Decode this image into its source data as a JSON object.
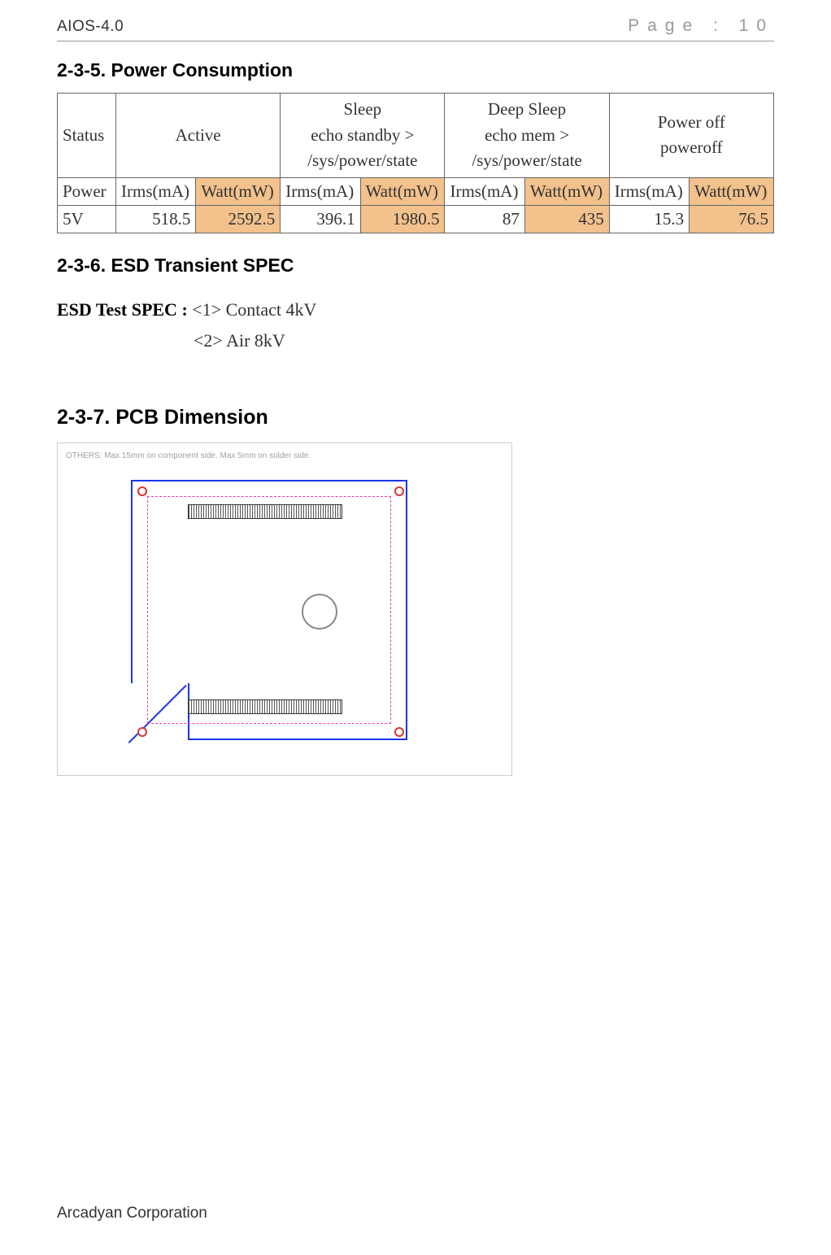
{
  "header": {
    "doc_code": "AIOS-4.0",
    "page_label": "Page : 10"
  },
  "section_235": {
    "heading": "2-3-5. Power Consumption",
    "cols": {
      "status": "Status",
      "active": "Active",
      "sleep_l1": "Sleep",
      "sleep_l2": "echo standby >",
      "sleep_l3": "/sys/power/state",
      "deep_l1": "Deep Sleep",
      "deep_l2": "echo mem >",
      "deep_l3": "/sys/power/state",
      "poweroff_l1": "Power off",
      "poweroff_l2": "poweroff"
    },
    "power_label": "Power",
    "irms_label": "Irms(mA)",
    "watt_label": "Watt(mW)",
    "voltage_label": "5V",
    "values": {
      "active_irms": "518.5",
      "active_watt": "2592.5",
      "sleep_irms": "396.1",
      "sleep_watt": "1980.5",
      "deep_irms": "87",
      "deep_watt": "435",
      "off_irms": "15.3",
      "off_watt": "76.5"
    }
  },
  "section_236": {
    "heading": "2-3-6. ESD Transient SPEC",
    "label": "ESD Test SPEC :",
    "item1": "<1> Contact 4kV",
    "item2": "<2> Air 8kV"
  },
  "section_237": {
    "heading": "2-3-7. PCB Dimension",
    "figure_note": "OTHERS: Max 15mm on component side. Max 5mm on solder side."
  },
  "footer": {
    "company": "Arcadyan Corporation"
  },
  "chart_data": {
    "type": "table",
    "title": "Power Consumption",
    "columns": [
      "Status",
      "Active Irms(mA)",
      "Active Watt(mW)",
      "Sleep Irms(mA)",
      "Sleep Watt(mW)",
      "Deep Sleep Irms(mA)",
      "Deep Sleep Watt(mW)",
      "Power off Irms(mA)",
      "Power off Watt(mW)"
    ],
    "rows": [
      {
        "voltage": "5V",
        "active_irms_mA": 518.5,
        "active_watt_mW": 2592.5,
        "sleep_irms_mA": 396.1,
        "sleep_watt_mW": 1980.5,
        "deep_sleep_irms_mA": 87,
        "deep_sleep_watt_mW": 435,
        "power_off_irms_mA": 15.3,
        "power_off_watt_mW": 76.5
      }
    ],
    "state_commands": {
      "Sleep": "echo standby > /sys/power/state",
      "Deep Sleep": "echo mem > /sys/power/state",
      "Power off": "poweroff"
    }
  }
}
